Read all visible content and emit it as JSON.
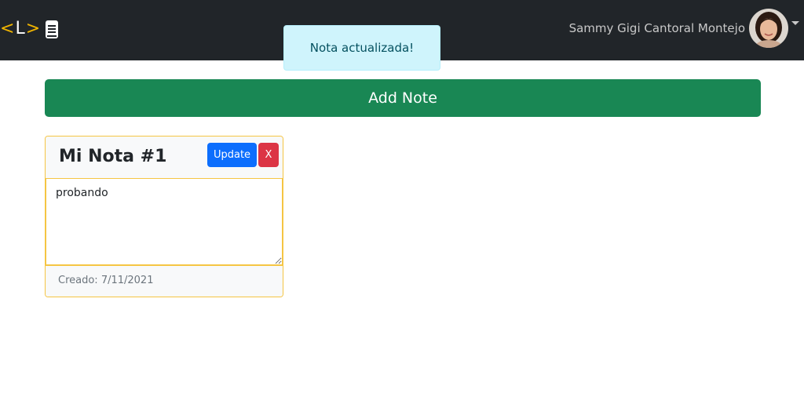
{
  "navbar": {
    "brand": {
      "lt": "<",
      "letter": "L",
      "gt": ">",
      "icon": "book-icon"
    },
    "user": {
      "name": "Sammy Gigi Cantoral Montejo",
      "avatar": "avatar-photo",
      "menu_icon": "caret-down-icon"
    }
  },
  "toast": {
    "message": "Nota actualizada!"
  },
  "actions": {
    "add_note_label": "Add Note"
  },
  "notes": [
    {
      "title": "Mi Nota #1",
      "update_label": "Update",
      "delete_label": "X",
      "content": "probando",
      "created_label": "Creado: 7/11/2021"
    }
  ],
  "colors": {
    "navbar_bg": "#212529",
    "brand_accent": "#f0b400",
    "toast_bg": "#cff4fc",
    "add_button": "#198754",
    "update_button": "#0d6efd",
    "delete_button": "#dc3545",
    "card_border": "#f5c543"
  }
}
